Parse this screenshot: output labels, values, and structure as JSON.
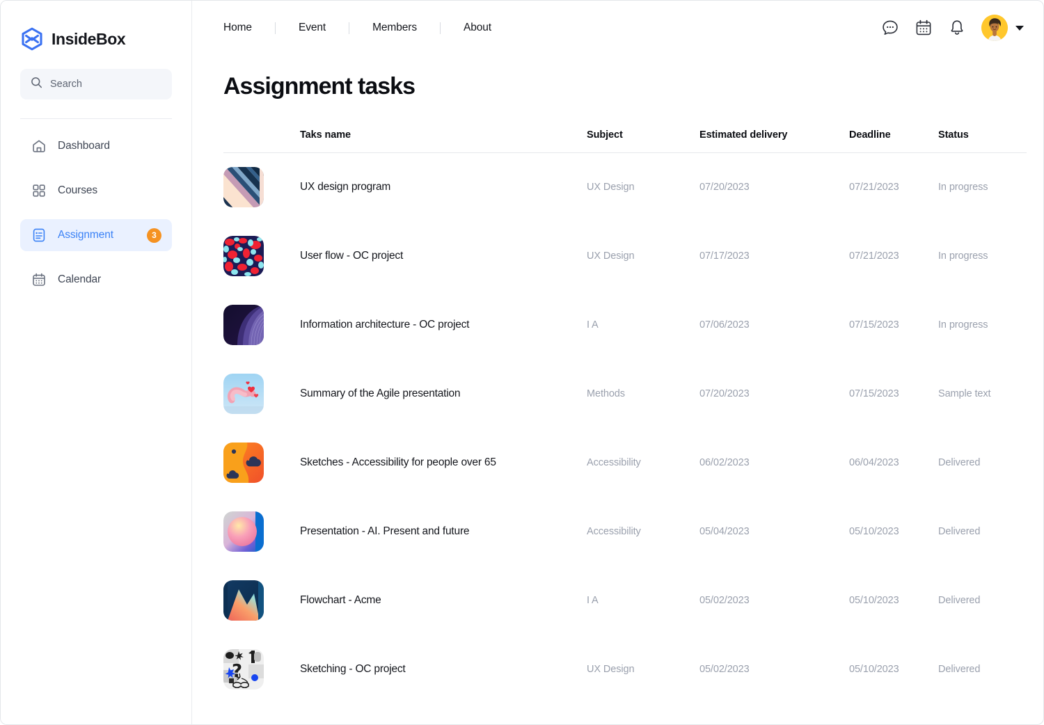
{
  "brand": {
    "name": "InsideBox",
    "logo_icon": "hexagon-box-logo-icon",
    "accent": "#3b82f6"
  },
  "search": {
    "placeholder": "Search",
    "value": "",
    "icon": "search-icon"
  },
  "sidebar": {
    "items": [
      {
        "label": "Dashboard",
        "icon": "home-icon",
        "active": false,
        "badge": ""
      },
      {
        "label": "Courses",
        "icon": "grid-squares-icon",
        "active": false,
        "badge": ""
      },
      {
        "label": "Assignment",
        "icon": "document-list-icon",
        "active": true,
        "badge": "3"
      },
      {
        "label": "Calendar",
        "icon": "calendar-icon",
        "active": false,
        "badge": ""
      }
    ],
    "badge_color": "#f59222",
    "active_bg": "#eaf1ff",
    "active_color": "#3b82f6"
  },
  "topnav": {
    "links": [
      "Home",
      "Event",
      "Members",
      "About"
    ]
  },
  "topbar_icons": [
    {
      "name": "chat-bubble-icon"
    },
    {
      "name": "calendar-icon"
    },
    {
      "name": "bell-icon"
    }
  ],
  "account": {
    "avatar_icon": "user-avatar",
    "caret_icon": "chevron-down-icon"
  },
  "page": {
    "title": "Assignment tasks"
  },
  "table": {
    "columns": [
      "",
      "Taks name",
      "Subject",
      "Estimated delivery",
      "Deadline",
      "Status"
    ],
    "rows": [
      {
        "thumb": "thumb-stripes-diagonal",
        "name": "UX design program",
        "subject": "UX Design",
        "estimated": "07/20/2023",
        "deadline": "07/21/2023",
        "status": "In progress"
      },
      {
        "thumb": "thumb-red-camo",
        "name": "User flow - OC project",
        "subject": "UX Design",
        "estimated": "07/17/2023",
        "deadline": "07/21/2023",
        "status": "In progress"
      },
      {
        "thumb": "thumb-dark-purple-wave",
        "name": "Information architecture - OC project",
        "subject": "I A",
        "estimated": "07/06/2023",
        "deadline": "07/15/2023",
        "status": "In progress"
      },
      {
        "thumb": "thumb-pink-knot-hearts",
        "name": "Summary of the Agile presentation",
        "subject": "Methods",
        "estimated": "07/20/2023",
        "deadline": "07/15/2023",
        "status": "Sample text"
      },
      {
        "thumb": "thumb-orange-clouds",
        "name": "Sketches - Accessibility for people over 65",
        "subject": "Accessibility",
        "estimated": "06/02/2023",
        "deadline": "06/04/2023",
        "status": "Delivered"
      },
      {
        "thumb": "thumb-pastel-sphere",
        "name": "Presentation - AI. Present and future",
        "subject": "Accessibility",
        "estimated": "05/04/2023",
        "deadline": "05/10/2023",
        "status": "Delivered"
      },
      {
        "thumb": "thumb-sunset-peak",
        "name": "Flowchart - Acme",
        "subject": "I A",
        "estimated": "05/02/2023",
        "deadline": "05/10/2023",
        "status": "Delivered"
      },
      {
        "thumb": "thumb-bw-collage",
        "name": "Sketching - OC project",
        "subject": "UX Design",
        "estimated": "05/02/2023",
        "deadline": "05/10/2023",
        "status": "Delivered"
      }
    ]
  }
}
